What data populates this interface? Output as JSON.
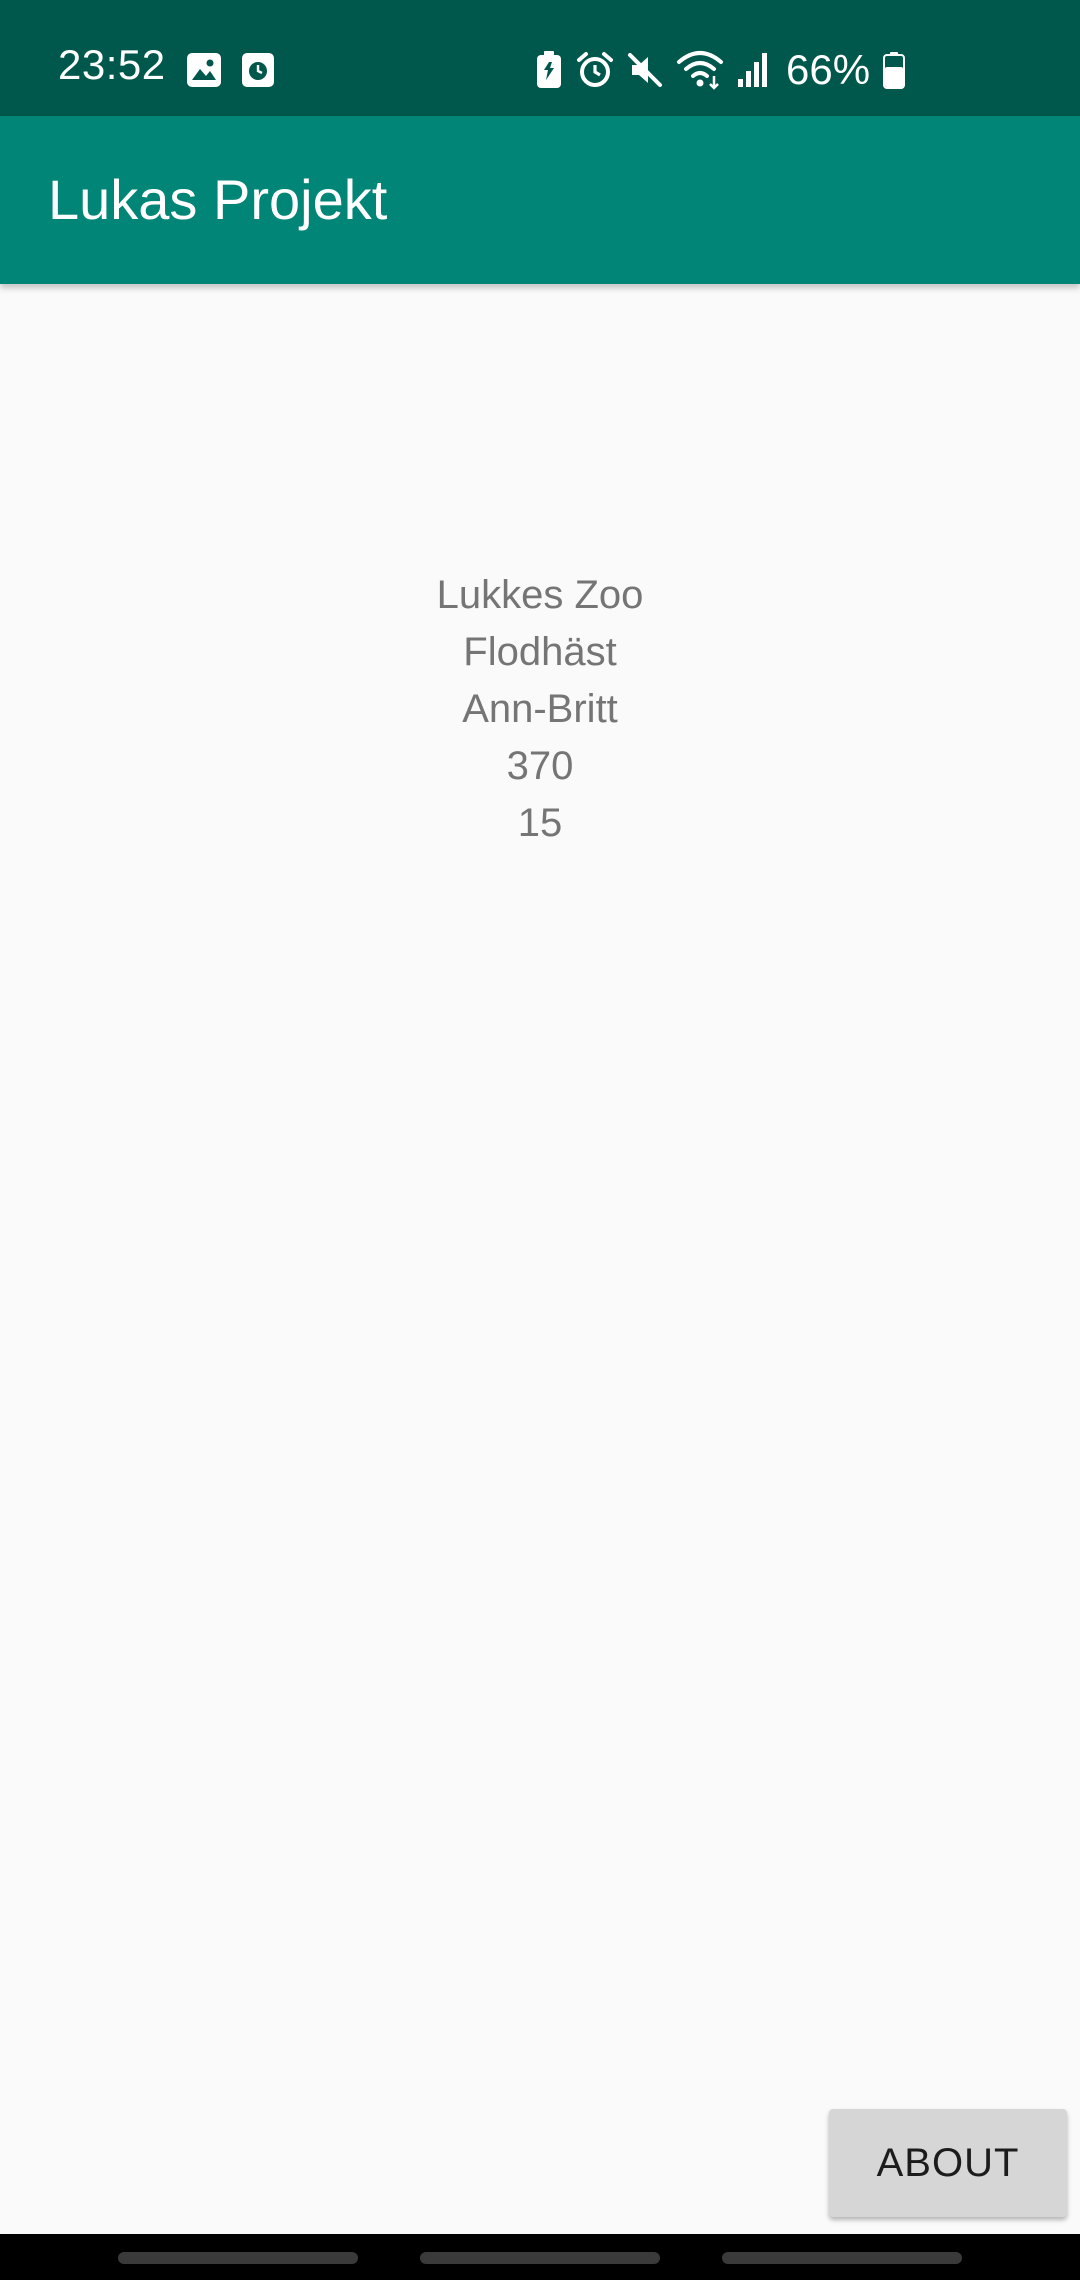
{
  "status_bar": {
    "time": "23:52",
    "battery_percent": "66%",
    "battery_level": 0.66,
    "left_icons": [
      "gallery-icon",
      "clock-app-icon"
    ],
    "right_icons": [
      "battery-saver-icon",
      "alarm-icon",
      "mute-icon",
      "wifi-icon",
      "signal-icon",
      "battery-icon"
    ],
    "background": "#00574b"
  },
  "app_bar": {
    "title": "Lukas Projekt",
    "background": "#008577"
  },
  "main": {
    "lines": [
      "Lukkes Zoo",
      "Flodhäst",
      "Ann-Britt",
      "370",
      "15"
    ]
  },
  "actions": {
    "about_label": "ABOUT"
  }
}
